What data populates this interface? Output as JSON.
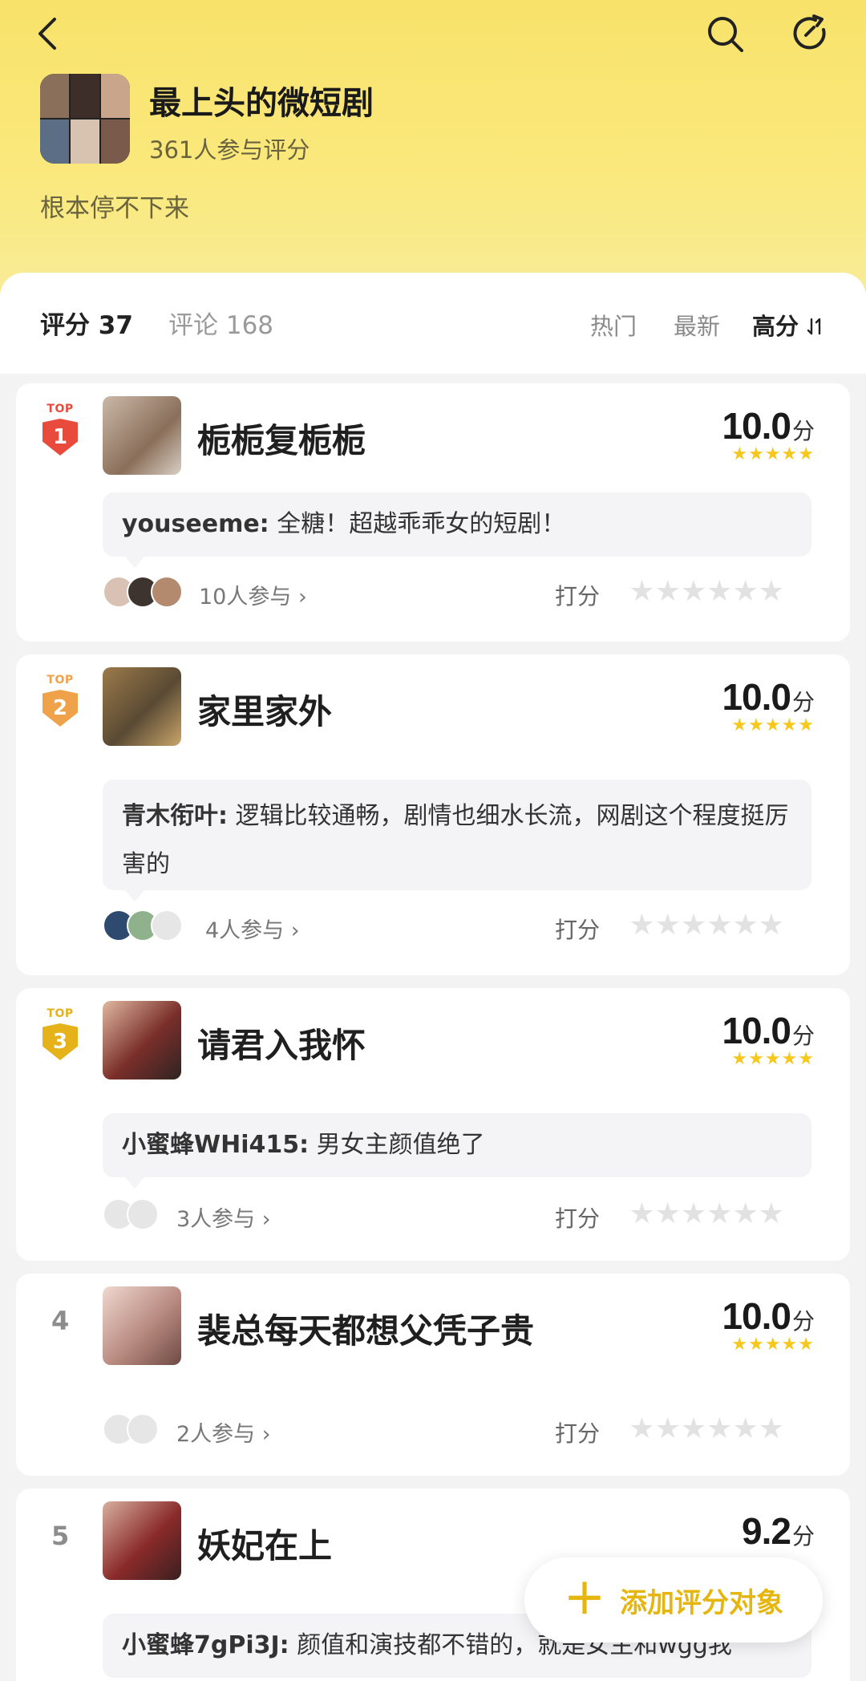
{
  "header": {
    "back_icon": "chevron-left-icon",
    "search_icon": "search-icon",
    "share_icon": "share-refresh-icon",
    "title": "最上头的微短剧",
    "participants": "361人参与评分",
    "description": "根本停不下来"
  },
  "tabs": {
    "rating": "评分 37",
    "comments": "评论 168"
  },
  "sort": {
    "hot": "热门",
    "newest": "最新",
    "high": "高分",
    "high_icon": "sort-arrows-icon"
  },
  "colors": {
    "accent": "#f8e26a",
    "star": "#f6c81b",
    "rank1": "#e84b3c",
    "rank2": "#f0a24a",
    "rank3": "#e6b21a",
    "fab": "#e5b60f"
  },
  "items": [
    {
      "rank_top": "TOP",
      "rank": "1",
      "title": "栀栀复栀栀",
      "score": "10.0",
      "unit": "分",
      "stars": "★★★★★",
      "quote_user": "youseeme:",
      "quote_text": "全糖！超越乖乖女的短剧！",
      "participants": "10人参与 ›",
      "rate_label": "打分",
      "rate_stars": "★★★★★★"
    },
    {
      "rank_top": "TOP",
      "rank": "2",
      "title": "家里家外",
      "score": "10.0",
      "unit": "分",
      "stars": "★★★★★",
      "quote_user": "青木衔叶:",
      "quote_text": "逻辑比较通畅，剧情也细水长流，网剧这个程度挺厉害的",
      "participants": "4人参与 ›",
      "rate_label": "打分",
      "rate_stars": "★★★★★★"
    },
    {
      "rank_top": "TOP",
      "rank": "3",
      "title": "请君入我怀",
      "score": "10.0",
      "unit": "分",
      "stars": "★★★★★",
      "quote_user": "小蜜蜂WHi415:",
      "quote_text": "男女主颜值绝了",
      "participants": "3人参与 ›",
      "rate_label": "打分",
      "rate_stars": "★★★★★★"
    },
    {
      "rank": "4",
      "title": "裴总每天都想父凭子贵",
      "score": "10.0",
      "unit": "分",
      "stars": "★★★★★",
      "participants": "2人参与 ›",
      "rate_label": "打分",
      "rate_stars": "★★★★★★"
    },
    {
      "rank": "5",
      "title": "妖妃在上",
      "score": "9.2",
      "unit": "分",
      "quote_user": "小蜜蜂7gPi3J:",
      "quote_text": "颜值和演技都不错的，就是女主和wgg我"
    }
  ],
  "fab": {
    "plus": "＋",
    "label": "添加评分对象"
  }
}
